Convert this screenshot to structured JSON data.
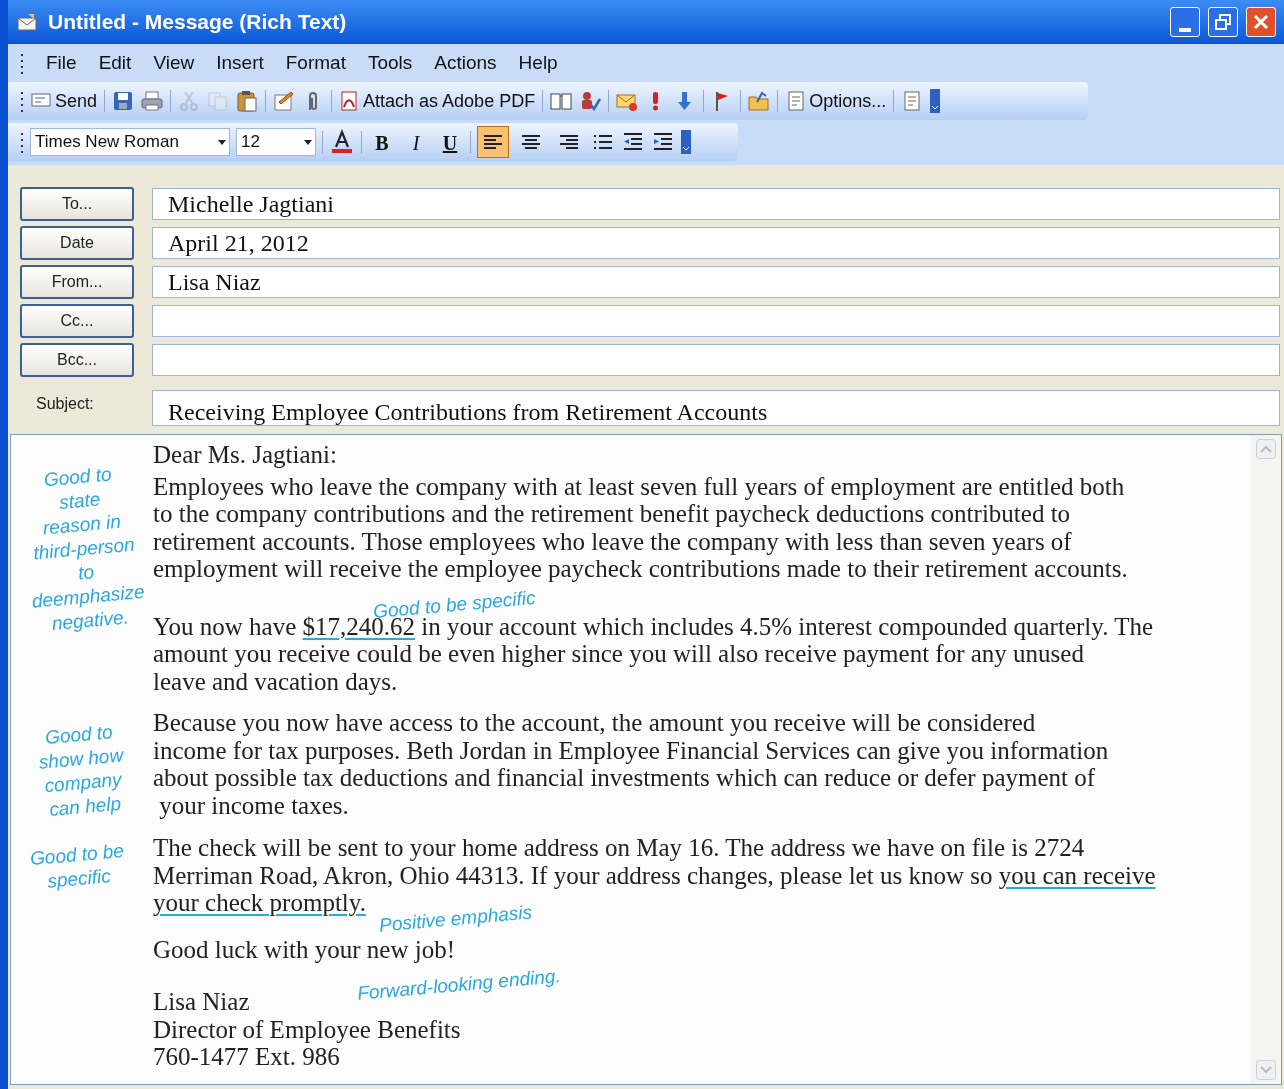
{
  "window": {
    "title": "Untitled - Message (Rich Text)"
  },
  "menu": [
    "File",
    "Edit",
    "View",
    "Insert",
    "Format",
    "Tools",
    "Actions",
    "Help"
  ],
  "standard_toolbar": [
    {
      "kind": "text-button",
      "label": "Send"
    },
    {
      "kind": "separator"
    },
    {
      "kind": "icon"
    },
    {
      "kind": "icon"
    },
    {
      "kind": "separator"
    },
    {
      "kind": "icon",
      "disabled": true
    },
    {
      "kind": "icon",
      "disabled": true
    },
    {
      "kind": "icon",
      "disabled": false
    },
    {
      "kind": "separator"
    },
    {
      "kind": "icon"
    },
    {
      "kind": "icon"
    },
    {
      "kind": "separator"
    },
    {
      "kind": "text-button",
      "label": "Attach as Adobe PDF"
    },
    {
      "kind": "separator"
    },
    {
      "kind": "icon"
    },
    {
      "kind": "icon"
    },
    {
      "kind": "separator"
    },
    {
      "kind": "icon"
    },
    {
      "kind": "icon"
    },
    {
      "kind": "icon"
    },
    {
      "kind": "separator"
    },
    {
      "kind": "icon"
    },
    {
      "kind": "separator"
    },
    {
      "kind": "icon"
    },
    {
      "kind": "separator"
    },
    {
      "kind": "text-button",
      "label": "Options..."
    },
    {
      "kind": "separator"
    },
    {
      "kind": "icon"
    }
  ],
  "format_toolbar": {
    "font": "Times New Roman",
    "size": "12",
    "bold": "B",
    "italic": "I",
    "underline": "U",
    "align": [
      {
        "selected": true
      },
      {
        "selected": false
      },
      {
        "selected": false
      }
    ]
  },
  "header": {
    "fields": [
      {
        "kind": "button",
        "label": "To...",
        "value": "Michelle Jagtiani"
      },
      {
        "kind": "button",
        "label": "Date",
        "value": "April 21, 2012"
      },
      {
        "kind": "button",
        "label": "From...",
        "value": "Lisa Niaz"
      },
      {
        "kind": "button",
        "label": "Cc..."
      },
      {
        "kind": "button",
        "label": "Bcc..."
      },
      {
        "kind": "label",
        "label": "Subject:",
        "value": "Receiving Employee Contributions from Retirement Accounts"
      }
    ]
  },
  "body": [
    {
      "lines": [
        [
          {
            "text": "Dear Ms. Jagtiani:"
          }
        ]
      ]
    },
    {
      "lines": [
        [
          {
            "text": "Employees who leave the company with at least seven full years of employment are entitled both"
          }
        ],
        [
          {
            "text": "to the company contributions and the retirement benefit paycheck deductions contributed to"
          }
        ],
        [
          {
            "text": "retirement accounts. Those employees who leave the company with less than seven years of"
          }
        ],
        [
          {
            "text": "employment will receive the employee paycheck contributions made to their retirement accounts."
          }
        ]
      ]
    },
    {
      "lines": [
        [
          {
            "text": "You now have "
          },
          {
            "text": "$17,240.62",
            "underlined": true
          },
          {
            "text": " in your account which includes 4.5% interest compounded quarterly. The"
          }
        ],
        [
          {
            "text": "amount you receive could be even higher since you will also receive payment for any unused"
          }
        ],
        [
          {
            "text": "leave and vacation days."
          }
        ]
      ]
    },
    {
      "lines": [
        [
          {
            "text": "Because you now have access to the account, the amount you receive will be considered"
          }
        ],
        [
          {
            "text": "income for tax purposes. Beth Jordan in Employee Financial Services can give you information"
          }
        ],
        [
          {
            "text": "about possible tax deductions and financial investments which can reduce or defer payment of"
          }
        ],
        [
          {
            "text": " your income taxes."
          }
        ]
      ]
    },
    {
      "lines": [
        [
          {
            "text": "The check will be sent to your home address on May 16. The address we have on file is 2724"
          }
        ],
        [
          {
            "text": "Merriman Road, Akron, Ohio 44313. If your address changes, please let us know so "
          },
          {
            "text": "you can receive",
            "underlined": true
          }
        ],
        [
          {
            "text": "your check promptly.",
            "underlined": true
          }
        ]
      ]
    },
    {
      "lines": [
        [
          {
            "text": "Good luck with your new job!"
          }
        ]
      ]
    },
    {
      "lines": [
        [
          {
            "text": "Lisa Niaz"
          }
        ],
        [
          {
            "text": "Director of Employee Benefits"
          }
        ],
        [
          {
            "text": "760-1477 Ext. 986"
          }
        ]
      ]
    }
  ],
  "annotations": [
    {
      "lines": [
        "Good to",
        "state",
        "reason in",
        "third-person",
        "to",
        "deemphasize",
        "negative."
      ]
    },
    {
      "lines": [
        "Good to be specific"
      ]
    },
    {
      "lines": [
        "Good to",
        "show how",
        "company",
        "can help"
      ]
    },
    {
      "lines": [
        "Good to be",
        "specific"
      ]
    },
    {
      "lines": [
        "Positive emphasis"
      ]
    },
    {
      "lines": [
        "Forward-looking ending."
      ]
    }
  ]
}
